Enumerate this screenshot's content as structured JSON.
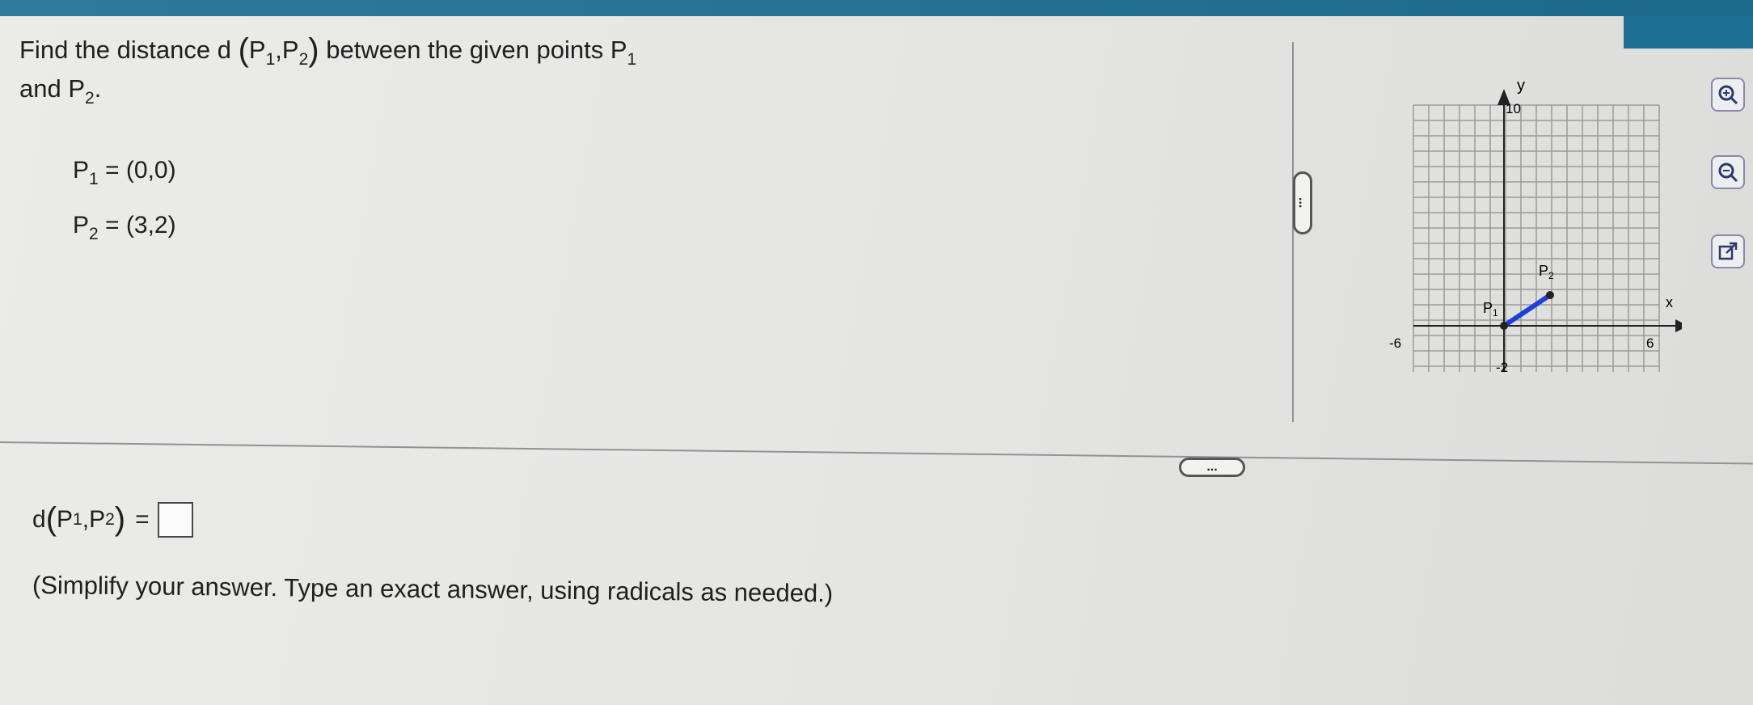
{
  "question": {
    "prefix": "Find the distance d",
    "open_paren": "(",
    "p1_label": "P",
    "p1_sub": "1",
    "comma": ",",
    "p2_label": "P",
    "p2_sub": "2",
    "close_paren": ")",
    "middle": "between the given points P",
    "middle_sub": "1",
    "line2_prefix": "and P",
    "line2_sub": "2",
    "line2_suffix": "."
  },
  "points": [
    {
      "name": "P",
      "sub": "1",
      "value": "= (0,0)"
    },
    {
      "name": "P",
      "sub": "2",
      "value": "= (3,2)"
    }
  ],
  "answer": {
    "prefix": "d",
    "open_paren": "(",
    "p1": "P",
    "p1_sub": "1",
    "comma": ",",
    "p2": "P",
    "p2_sub": "2",
    "close_paren": ")",
    "equals": "=",
    "instruction": "(Simplify your answer. Type an exact answer, using radicals as needed.)"
  },
  "graph": {
    "x_label": "x",
    "y_label": "y",
    "tick_neg6": "-6",
    "tick_6": "6",
    "tick_10": "10",
    "tick_neg2": "-2",
    "point_labels": [
      {
        "name": "P",
        "sub": "1",
        "x": 0,
        "y": 0
      },
      {
        "name": "P",
        "sub": "2",
        "x": 3,
        "y": 2
      }
    ],
    "segment_color": "#1f3fd8"
  },
  "splitters": {
    "dots": "..."
  },
  "toolbar": {
    "zoom_in": "zoom-in-icon",
    "zoom_out": "zoom-out-icon",
    "open_new": "external-link-icon"
  },
  "colors": {
    "topbar": "#1d6f93",
    "segment": "#1f3fd8"
  }
}
